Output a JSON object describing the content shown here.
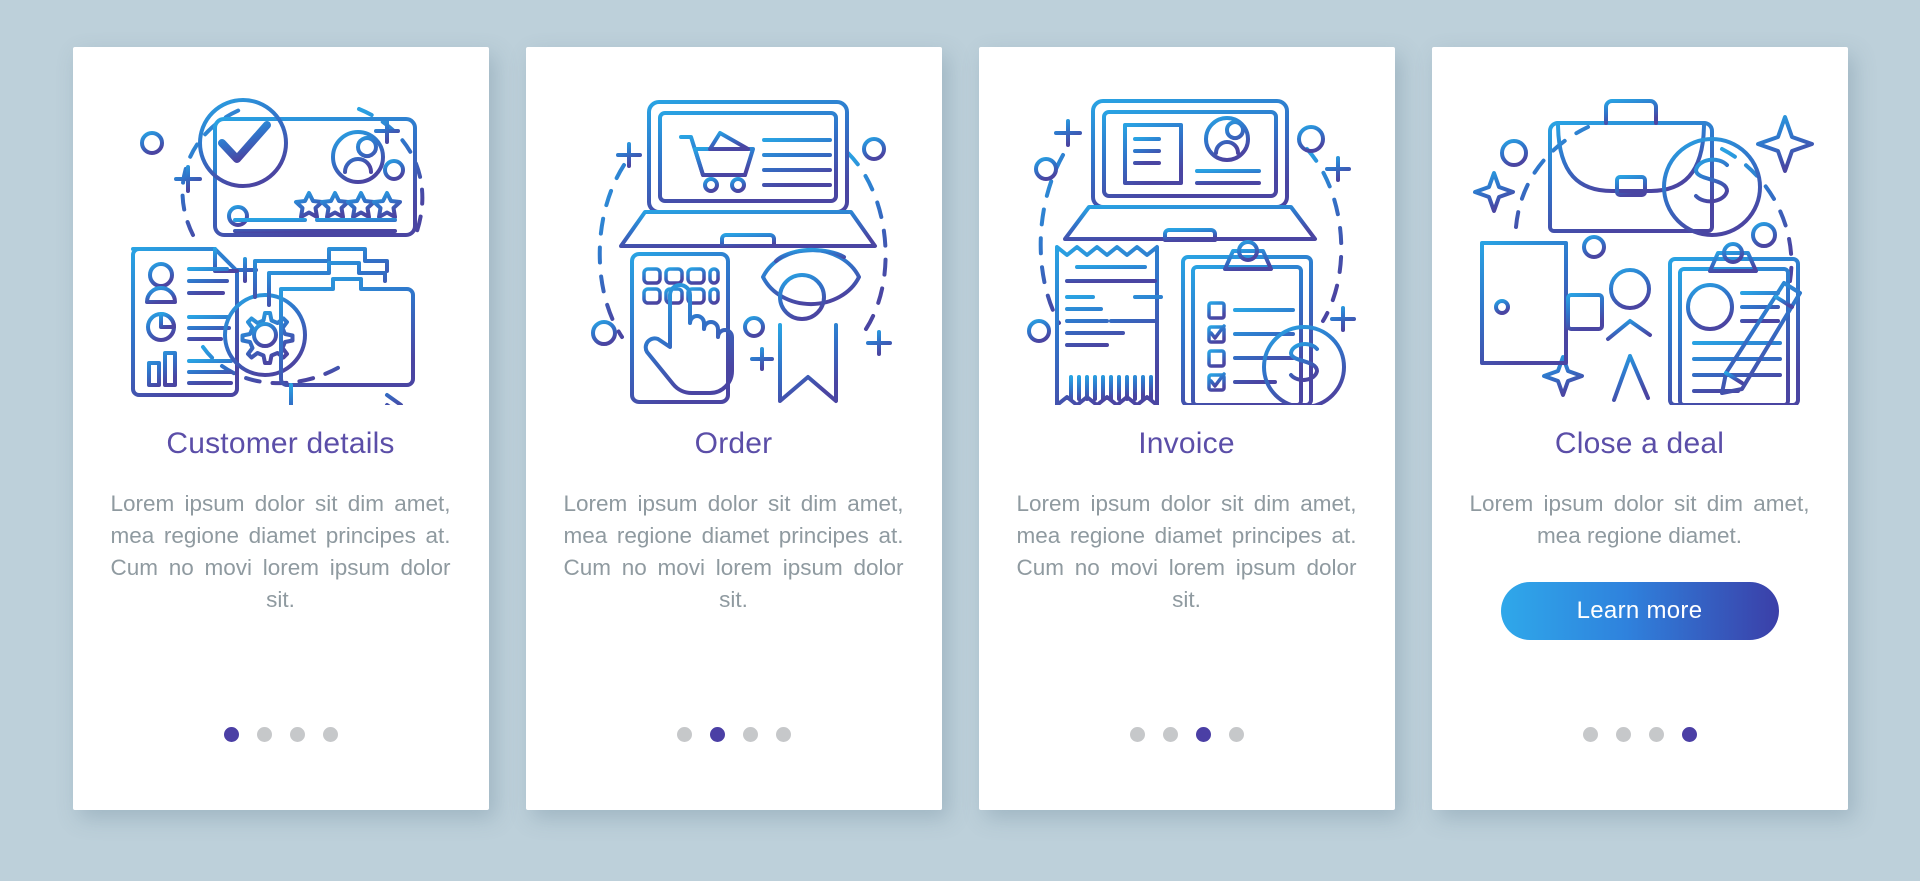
{
  "page": {
    "background_color": "#bdd0da",
    "card_background": "#ffffff",
    "title_color": "#5b4ea8",
    "body_color": "#8f9aa0",
    "dot_active_color": "#4b3fa5",
    "dot_inactive_color": "#c6c8ca",
    "illustration_gradient_start": "#2b9fe0",
    "illustration_gradient_end": "#4a4aa0",
    "button_gradient_start": "#2fa8ea",
    "button_gradient_end": "#3b3fa8",
    "total_steps": 4
  },
  "screens": [
    {
      "title": "Customer details",
      "body": "Lorem ipsum dolor sit dim amet, mea regione diamet principes at. Cum no movi lorem ipsum dolor sit.",
      "illustration": "customer-details-illustration",
      "icons": [
        "check-badge-icon",
        "id-card-icon",
        "star-rating-icon",
        "resume-document-icon",
        "gear-icon",
        "folder-icon",
        "arrow-icon"
      ],
      "active_step": 1,
      "button": null
    },
    {
      "title": "Order",
      "body": "Lorem ipsum dolor sit dim amet, mea regione diamet principes at. Cum no movi lorem ipsum dolor sit.",
      "illustration": "order-illustration",
      "icons": [
        "laptop-icon",
        "shopping-cart-icon",
        "smartphone-icon",
        "hand-pointer-icon",
        "award-ribbon-icon"
      ],
      "active_step": 2,
      "button": null
    },
    {
      "title": "Invoice",
      "body": "Lorem ipsum dolor sit dim amet, mea regione diamet principes at. Cum no movi lorem ipsum dolor sit.",
      "illustration": "invoice-illustration",
      "icons": [
        "laptop-icon",
        "user-profile-icon",
        "receipt-icon",
        "barcode-icon",
        "clipboard-checklist-icon",
        "dollar-coin-icon"
      ],
      "active_step": 3,
      "button": null
    },
    {
      "title": "Close a deal",
      "body": "Lorem ipsum dolor sit dim amet, mea regione diamet.",
      "illustration": "close-a-deal-illustration",
      "icons": [
        "briefcase-icon",
        "dollar-coin-icon",
        "door-icon",
        "walking-person-icon",
        "clipboard-icon",
        "pen-icon",
        "sparkle-icon"
      ],
      "active_step": 4,
      "button": "Learn more"
    }
  ]
}
